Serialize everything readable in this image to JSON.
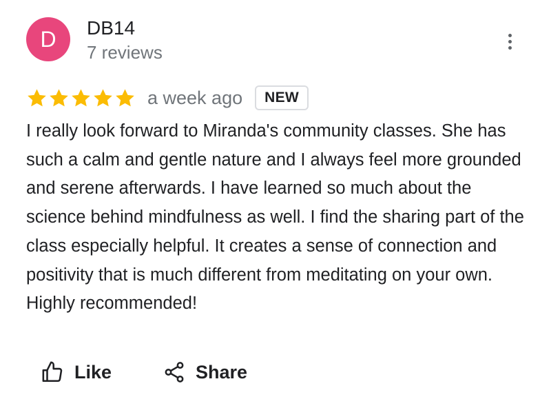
{
  "reviewer": {
    "initial": "D",
    "name": "DB14",
    "review_count": "7 reviews",
    "avatar_color": "#e8467c"
  },
  "menu": {
    "icon": "more-vert-icon"
  },
  "review": {
    "rating": 5,
    "rating_max": 5,
    "star_color": "#fbbc04",
    "time": "a week ago",
    "badge": "NEW",
    "text": "I really look forward to Miranda's community classes. She has such a calm and gentle nature and I always feel more grounded and serene afterwards. I have learned so much about the science behind mindfulness as well. I find the sharing part of the class especially helpful. It creates a sense of connection and positivity that is much different from meditating on your own. Highly recommended!"
  },
  "actions": {
    "like_label": "Like",
    "like_icon": "thumb-up-icon",
    "share_label": "Share",
    "share_icon": "share-icon"
  }
}
